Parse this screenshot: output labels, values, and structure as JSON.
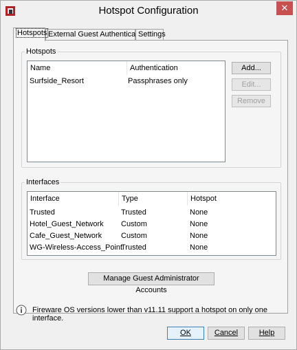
{
  "window": {
    "title": "Hotspot Configuration",
    "close_label": "✕"
  },
  "tabs": [
    {
      "label": "Hotspots",
      "active": true
    },
    {
      "label": "External Guest Authentication",
      "active": false
    },
    {
      "label": "Settings",
      "active": false
    }
  ],
  "hotspots": {
    "group_label": "Hotspots",
    "columns": [
      "Name",
      "Authentication"
    ],
    "rows": [
      {
        "name": "Surfside_Resort",
        "authentication": "Passphrases only"
      }
    ],
    "buttons": {
      "add": "Add...",
      "edit": "Edit...",
      "remove": "Remove"
    }
  },
  "interfaces": {
    "group_label": "Interfaces",
    "columns": [
      "Interface",
      "Type",
      "Hotspot"
    ],
    "rows": [
      {
        "interface": "Trusted",
        "type": "Trusted",
        "hotspot": "None"
      },
      {
        "interface": "Hotel_Guest_Network",
        "type": "Custom",
        "hotspot": "None"
      },
      {
        "interface": "Cafe_Guest_Network",
        "type": "Custom",
        "hotspot": "None"
      },
      {
        "interface": "WG-Wireless-Access_Point",
        "type": "Trusted",
        "hotspot": "None"
      }
    ]
  },
  "manage_button": "Manage Guest Administrator Accounts",
  "info": {
    "icon": "info-icon",
    "text": "Fireware OS versions lower than v11.11 support a hotspot on only one interface."
  },
  "footer": {
    "ok": "OK",
    "cancel": "Cancel",
    "help": "Help"
  },
  "colors": {
    "close_button": "#c75050",
    "default_button_border": "#3c7fb1"
  }
}
